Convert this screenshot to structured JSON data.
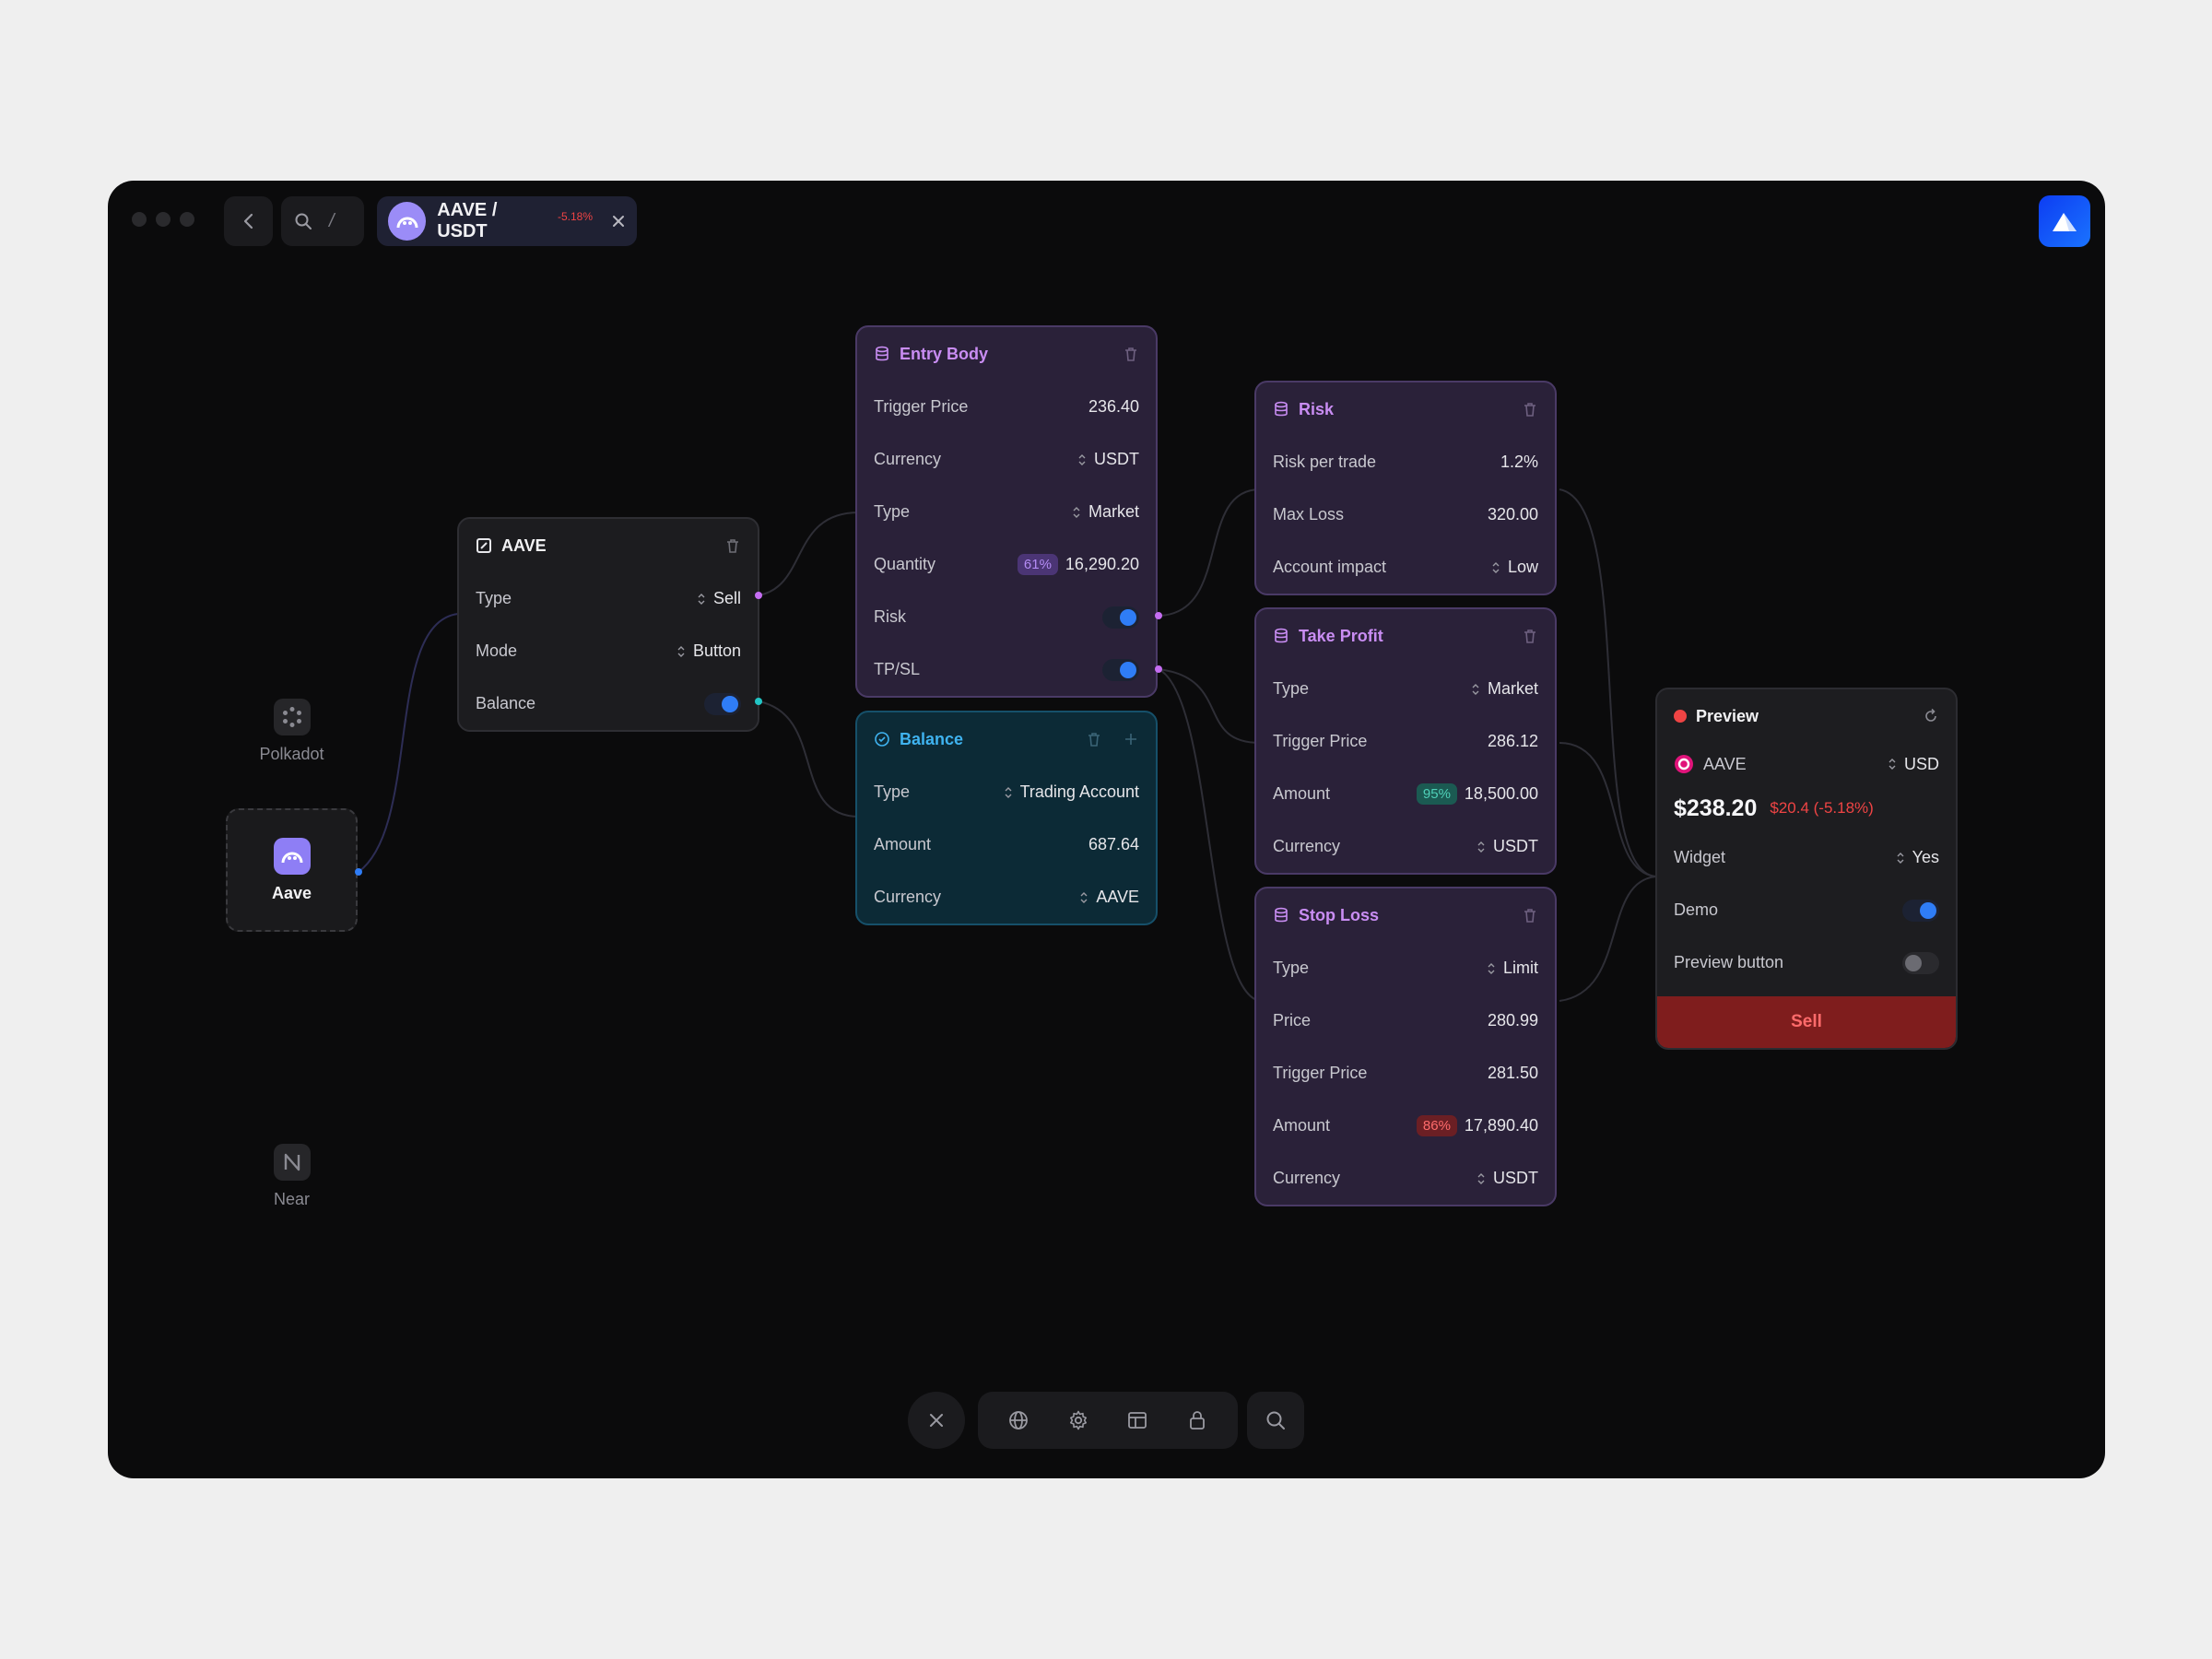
{
  "tab": {
    "pair": "AAVE / USDT",
    "change": "-5.18%"
  },
  "search": {
    "shortcut": "/"
  },
  "tokens": [
    {
      "name": "Polkadot"
    },
    {
      "name": "Aave"
    },
    {
      "name": "Near"
    }
  ],
  "aave_node": {
    "title": "AAVE",
    "rows": [
      {
        "label": "Type",
        "value": "Sell"
      },
      {
        "label": "Mode",
        "value": "Button"
      },
      {
        "label": "Balance",
        "toggle": true
      }
    ]
  },
  "entry_node": {
    "title": "Entry Body",
    "rows": [
      {
        "label": "Trigger Price",
        "value": "236.40"
      },
      {
        "label": "Currency",
        "value": "USDT"
      },
      {
        "label": "Type",
        "value": "Market"
      },
      {
        "label": "Quantity",
        "badge": "61%",
        "value": "16,290.20"
      },
      {
        "label": "Risk",
        "toggle": true
      },
      {
        "label": "TP/SL",
        "toggle": true
      }
    ]
  },
  "balance_node": {
    "title": "Balance",
    "rows": [
      {
        "label": "Type",
        "value": "Trading Account"
      },
      {
        "label": "Amount",
        "value": "687.64"
      },
      {
        "label": "Currency",
        "value": "AAVE"
      }
    ]
  },
  "risk_node": {
    "title": "Risk",
    "rows": [
      {
        "label": "Risk per trade",
        "value": "1.2%"
      },
      {
        "label": "Max Loss",
        "value": "320.00"
      },
      {
        "label": "Account impact",
        "value": "Low"
      }
    ]
  },
  "tp_node": {
    "title": "Take Profit",
    "rows": [
      {
        "label": "Type",
        "value": "Market"
      },
      {
        "label": "Trigger Price",
        "value": "286.12"
      },
      {
        "label": "Amount",
        "badge": "95%",
        "value": "18,500.00"
      },
      {
        "label": "Currency",
        "value": "USDT"
      }
    ]
  },
  "sl_node": {
    "title": "Stop Loss",
    "rows": [
      {
        "label": "Type",
        "value": "Limit"
      },
      {
        "label": "Price",
        "value": "280.99"
      },
      {
        "label": "Trigger Price",
        "value": "281.50"
      },
      {
        "label": "Amount",
        "badge": "86%",
        "value": "17,890.40"
      },
      {
        "label": "Currency",
        "value": "USDT"
      }
    ]
  },
  "preview_node": {
    "title": "Preview",
    "asset": "AAVE",
    "quote": "USD",
    "price": "$238.20",
    "price_change": "$20.4 (-5.18%)",
    "widget_label": "Widget",
    "widget_value": "Yes",
    "demo_label": "Demo",
    "demo_on": true,
    "preview_button_label": "Preview button",
    "preview_button_on": false,
    "sell_label": "Sell"
  },
  "colors": {
    "purple_accent": "#c98df3",
    "teal_accent": "#3fb3f0",
    "toggle_on": "#2f7df6",
    "sell_bg": "#7f1d1d",
    "negative": "#ef4444"
  },
  "icons": {
    "node": "database-icon",
    "delete": "trash-icon",
    "preview_refresh": "refresh-icon",
    "toolbar": [
      "close-icon",
      "globe-icon",
      "gear-icon",
      "layout-icon",
      "lock-icon",
      "search-icon"
    ]
  }
}
